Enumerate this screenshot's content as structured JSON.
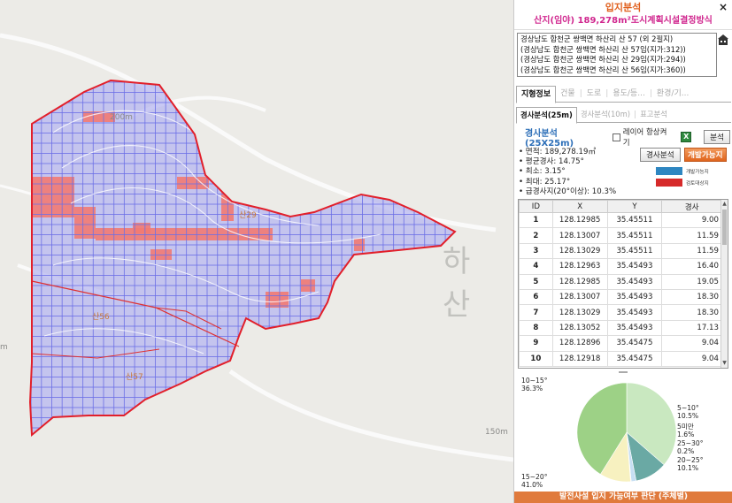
{
  "panel": {
    "title": "입지분석",
    "subtitle": "산지(임야) 189,278m²도시계획시설결정방식",
    "close": "×",
    "addresses": [
      "경상남도 합천군 쌍백면 하산리 산 57 (외 2필지)",
      "(경상남도 합천군 쌍백면 하산리 산 57임(지가:312))",
      "(경상남도 합천군 쌍백면 하산리 산 29임(지가:294))",
      "(경상남도 합천군 쌍백면 하산리 산 56임(지가:360))"
    ],
    "tabs": [
      "지형정보",
      "건물",
      "도로",
      "용도/등...",
      "환경/기..."
    ],
    "subtabs": [
      "경사분석(25m)",
      "경사분석(10m)",
      "표고분석"
    ],
    "analysis_title": "경사분석(25X25m)",
    "layer_checkbox_label": "레이어 항상켜기",
    "excel_icon": "excel-icon",
    "analyze_button": "분석",
    "slope_button": "경사분석",
    "develop_button": "개발가능지",
    "stats": [
      "• 면적: 189,278.19㎡",
      "• 평균경사: 14.75°",
      "• 최소: 3.15°",
      "• 최대: 25.17°",
      "• 급경사지(20°이상): 10.3%"
    ],
    "legend": [
      {
        "label": "개발가능지",
        "color": "#2e86c1"
      },
      {
        "label": "검토대상지",
        "color": "#d62a2a"
      }
    ],
    "table": {
      "headers": [
        "ID",
        "X",
        "Y",
        "경사"
      ],
      "rows": [
        [
          "1",
          "128.12985",
          "35.45511",
          "9.00"
        ],
        [
          "2",
          "128.13007",
          "35.45511",
          "11.59"
        ],
        [
          "3",
          "128.13029",
          "35.45511",
          "11.59"
        ],
        [
          "4",
          "128.12963",
          "35.45493",
          "16.40"
        ],
        [
          "5",
          "128.12985",
          "35.45493",
          "19.05"
        ],
        [
          "6",
          "128.13007",
          "35.45493",
          "18.30"
        ],
        [
          "7",
          "128.13029",
          "35.45493",
          "18.30"
        ],
        [
          "8",
          "128.13052",
          "35.45493",
          "17.13"
        ],
        [
          "9",
          "128.12896",
          "35.45475",
          "9.04"
        ],
        [
          "10",
          "128.12918",
          "35.45475",
          "9.04"
        ]
      ]
    },
    "pie": {
      "slices": [
        {
          "label": "10~15°",
          "value": 36.3,
          "color": "#c9e8c0"
        },
        {
          "label": "5~10°",
          "value": 10.5,
          "color": "#6aa9a4"
        },
        {
          "label": "5미만",
          "value": 1.6,
          "color": "#c7dff3"
        },
        {
          "label": "25~30°",
          "value": 0.2,
          "color": "#e7c2b6"
        },
        {
          "label": "20~25°",
          "value": 10.1,
          "color": "#f7f1c0"
        },
        {
          "label": "15~20°",
          "value": 41.0,
          "color": "#9dd186"
        }
      ],
      "pct_labels": [
        "36.3%",
        "10.5%",
        "1.6%",
        "0.2%",
        "10.1%",
        "41.0%"
      ]
    },
    "bottom_button": "발전사설 입지 가능여부 판단 (주체별)"
  },
  "map": {
    "place_label": "하 산",
    "contour_labels": [
      "200m",
      "150m",
      "m"
    ],
    "parcel_labels": [
      "산29",
      "산56",
      "산57"
    ]
  }
}
